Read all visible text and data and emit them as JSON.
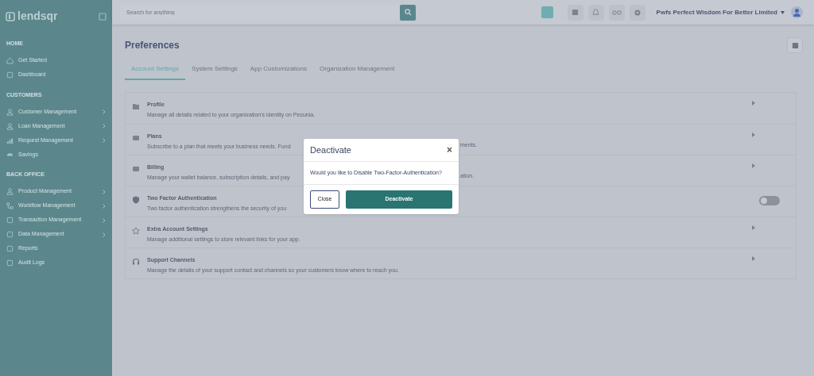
{
  "sidebar": {
    "logo": "lendsqr",
    "sections": [
      {
        "title": "HOME",
        "items": [
          {
            "label": "Get Started",
            "expandable": false
          },
          {
            "label": "Dashboard",
            "expandable": false
          }
        ]
      },
      {
        "title": "CUSTOMERS",
        "items": [
          {
            "label": "Customer Management",
            "expandable": true
          },
          {
            "label": "Loan Management",
            "expandable": true
          },
          {
            "label": "Request Management",
            "expandable": true
          },
          {
            "label": "Savings",
            "expandable": false
          }
        ]
      },
      {
        "title": "BACK OFFICE",
        "items": [
          {
            "label": "Product Management",
            "expandable": true
          },
          {
            "label": "Workflow Management",
            "expandable": true
          },
          {
            "label": "Transaction Management",
            "expandable": true
          },
          {
            "label": "Data Management",
            "expandable": true
          },
          {
            "label": "Reports",
            "expandable": false
          },
          {
            "label": "Audit Logs",
            "expandable": false
          }
        ]
      }
    ]
  },
  "topbar": {
    "search": {
      "placeholder": "Search for anything"
    },
    "organization": "Pwfs Perfect Wisdom For Better Limited"
  },
  "page": {
    "title": "Preferences",
    "tabs": [
      {
        "label": "Account Settings",
        "selected": true
      },
      {
        "label": "System Settings",
        "selected": false
      },
      {
        "label": "App Customizations",
        "selected": false
      },
      {
        "label": "Organization Management",
        "selected": false
      }
    ],
    "settings": [
      {
        "kind": "link",
        "title": "Profile",
        "description": "Manage all details related to your organization's identity on Pecunia."
      },
      {
        "kind": "link",
        "title": "Plans",
        "description": "Subscribe to a plan that meets your business needs. Fund",
        "description_tail": "ments."
      },
      {
        "kind": "link",
        "title": "Billing",
        "description": "Manage your wallet balance, subscription details, and pay",
        "description_tail": "ation."
      },
      {
        "kind": "toggle",
        "title": "Two Factor Authentication",
        "description": "Two factor authentication strengthens the security of you",
        "on": false
      },
      {
        "kind": "link",
        "title": "Extra Account Settings",
        "description": "Manage additional settings to store relevant links for your app."
      },
      {
        "kind": "link",
        "title": "Support Channels",
        "description": "Manage the details of your support contact and channels so your customers know where to reach you."
      }
    ]
  },
  "dialog": {
    "title": "Deactivate",
    "close": "×",
    "message": "Would you like to Disable Two-Factor-Authentication?",
    "buttons": [
      {
        "label": "Close",
        "kind": "secondary"
      },
      {
        "label": "Deactivate",
        "kind": "primary"
      }
    ]
  }
}
